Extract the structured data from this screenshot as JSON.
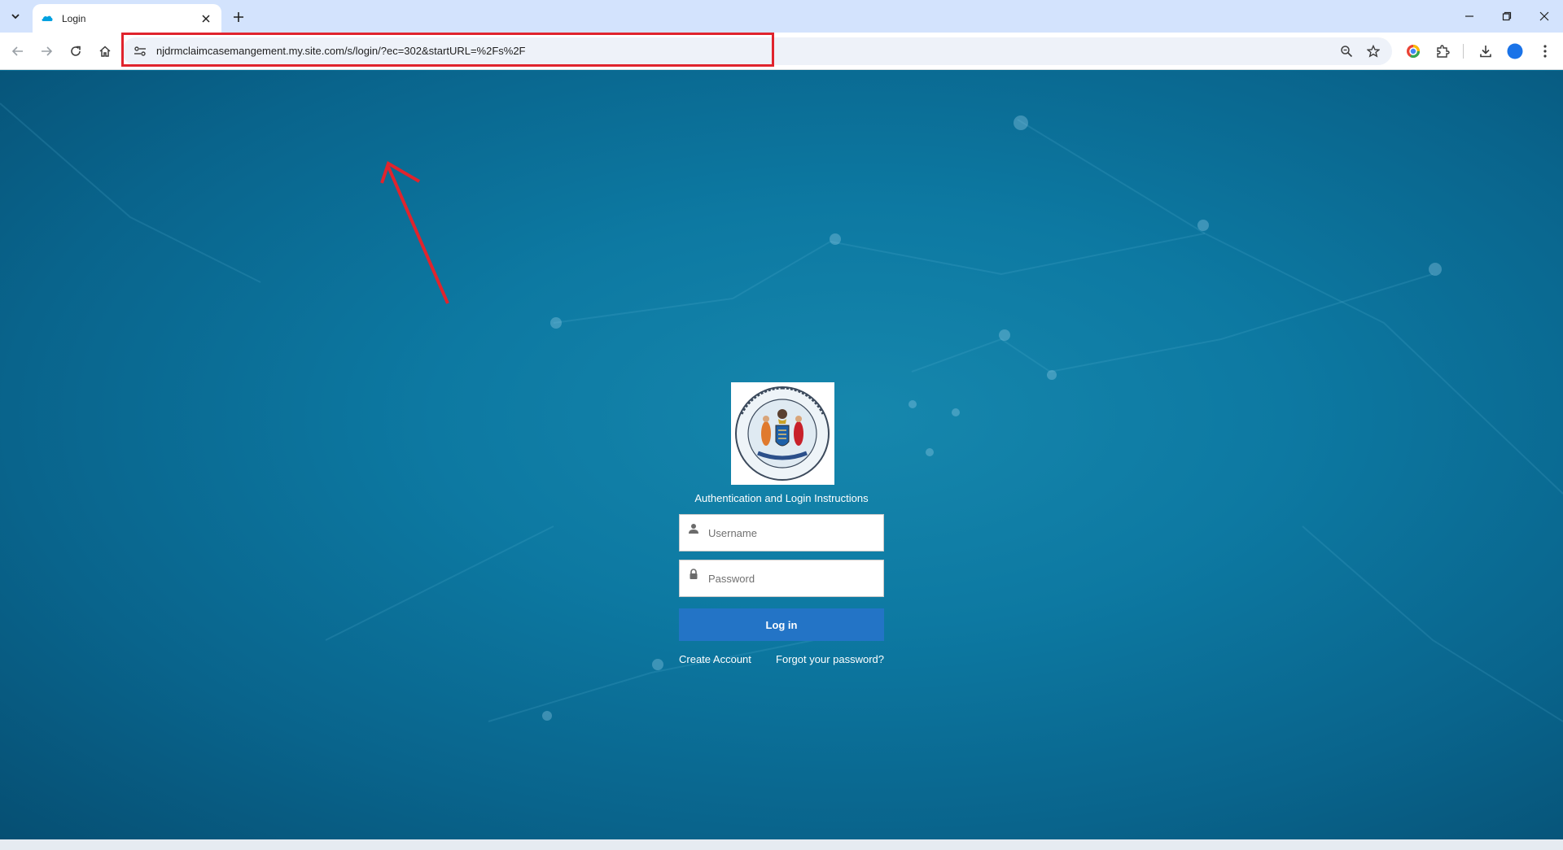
{
  "browser": {
    "tab": {
      "title": "Login"
    },
    "address_bar": {
      "url": "njdrmclaimcasemangement.my.site.com/s/login/?ec=302&startURL=%2Fs%2F"
    }
  },
  "login": {
    "instructions_link": "Authentication and Login Instructions",
    "username_placeholder": "Username",
    "password_placeholder": "Password",
    "login_button": "Log in",
    "create_account_link": "Create Account",
    "forgot_password_link": "Forgot your password?"
  },
  "taskbar": {
    "clock": ""
  },
  "colors": {
    "highlight": "#e0242d",
    "login_button": "#2374c6",
    "background": "#0a6f96"
  }
}
